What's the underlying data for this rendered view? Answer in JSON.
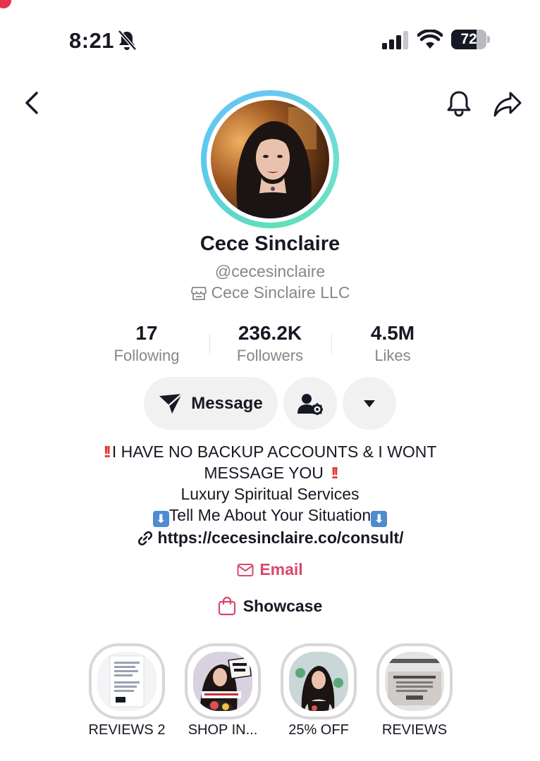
{
  "status_bar": {
    "time": "8:21",
    "battery": "72",
    "battery_level": 0.72,
    "icons": [
      "bell-slash-icon",
      "cellular-signal-icon",
      "wifi-icon",
      "battery-icon"
    ]
  },
  "nav": {
    "icons": [
      "chevron-left-icon",
      "bell-icon",
      "share-arrow-icon"
    ]
  },
  "profile": {
    "display_name": "Cece Sinclaire",
    "handle": "@cecesinclaire",
    "business": "Cece Sinclaire LLC",
    "ring_colors": [
      "#68c7f0",
      "#5fe0b8"
    ]
  },
  "stats": [
    {
      "number": "17",
      "label": "Following"
    },
    {
      "number": "236.2K",
      "label": "Followers"
    },
    {
      "number": "4.5M",
      "label": "Likes"
    }
  ],
  "actions": {
    "message_label": "Message"
  },
  "bio": {
    "line1": "I HAVE NO BACKUP ACCOUNTS & I WONT",
    "line2": "MESSAGE YOU",
    "line3": "Luxury Spiritual Services",
    "line4": "Tell Me About Your Situation",
    "mark": "!!",
    "arrow": "⬇"
  },
  "link": "https://cecesinclaire.co/consult/",
  "email_label": "Email",
  "showcase_label": "Showcase",
  "highlights": [
    {
      "label": "REVIEWS 2"
    },
    {
      "label": "SHOP IN..."
    },
    {
      "label": "25% OFF"
    },
    {
      "label": "REVIEWS"
    }
  ],
  "colors": {
    "accent_pink": "#d9496a",
    "alert_red": "#e4312c",
    "muted_text": "#86878b",
    "button_bg": "#f1f1f2"
  }
}
